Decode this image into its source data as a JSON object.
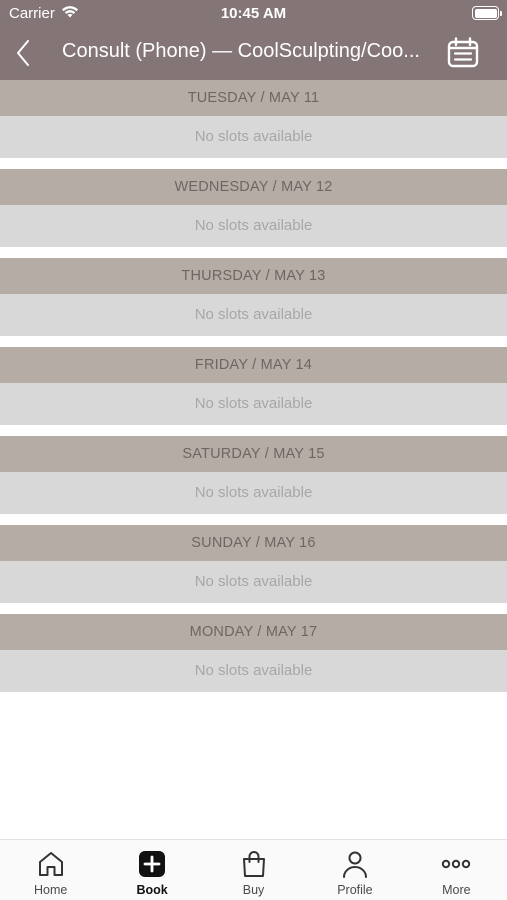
{
  "status_bar": {
    "carrier": "Carrier",
    "time": "10:45 AM",
    "wifi_icon": "wifi-icon",
    "battery_icon": "battery-icon"
  },
  "nav": {
    "title": "Consult (Phone) — CoolSculpting/Coo...",
    "back_icon": "chevron-left-icon",
    "calendar_icon": "calendar-icon"
  },
  "colors": {
    "header_bg": "#847577",
    "day_header_bg": "#b6aca6",
    "day_body_bg": "#d8d8d8"
  },
  "days": [
    {
      "header": "TUESDAY / MAY 11",
      "message": "No slots available"
    },
    {
      "header": "WEDNESDAY / MAY 12",
      "message": "No slots available"
    },
    {
      "header": "THURSDAY / MAY 13",
      "message": "No slots available"
    },
    {
      "header": "FRIDAY / MAY 14",
      "message": "No slots available"
    },
    {
      "header": "SATURDAY / MAY 15",
      "message": "No slots available"
    },
    {
      "header": "SUNDAY / MAY 16",
      "message": "No slots available"
    },
    {
      "header": "MONDAY / MAY 17",
      "message": "No slots available"
    }
  ],
  "tab_bar": {
    "tabs": [
      {
        "label": "Home",
        "icon": "home-icon"
      },
      {
        "label": "Book",
        "icon": "plus-square-icon",
        "active": true
      },
      {
        "label": "Buy",
        "icon": "shopping-bag-icon"
      },
      {
        "label": "Profile",
        "icon": "person-icon"
      },
      {
        "label": "More",
        "icon": "more-icon"
      }
    ]
  }
}
